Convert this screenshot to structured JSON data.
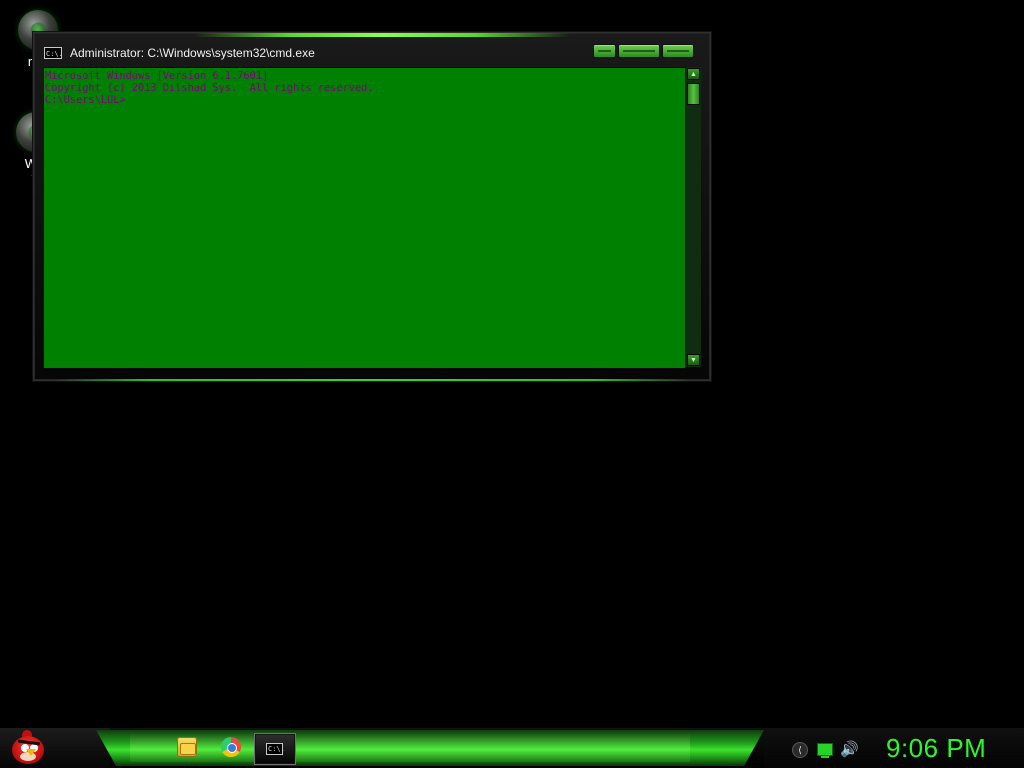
{
  "desktop": {
    "icons": [
      {
        "label": "mis"
      },
      {
        "label_line1": "Win",
        "label_line2": "V"
      }
    ]
  },
  "cmd_window": {
    "title": "Administrator: C:\\Windows\\system32\\cmd.exe",
    "title_icon_glyph": "C:\\.",
    "lines": [
      "Microsoft Windows [Version 6.1.7601]",
      "Copyright (c) 2013 Dilshad Sys.  All rights reserved.",
      "",
      "C:\\Users\\LUL>"
    ],
    "colors": {
      "background": "#008000",
      "text": "#800080"
    }
  },
  "taskbar": {
    "cmd_task_glyph": "C:\\.",
    "clock": "9:06 PM",
    "accent": "#3be12f"
  }
}
